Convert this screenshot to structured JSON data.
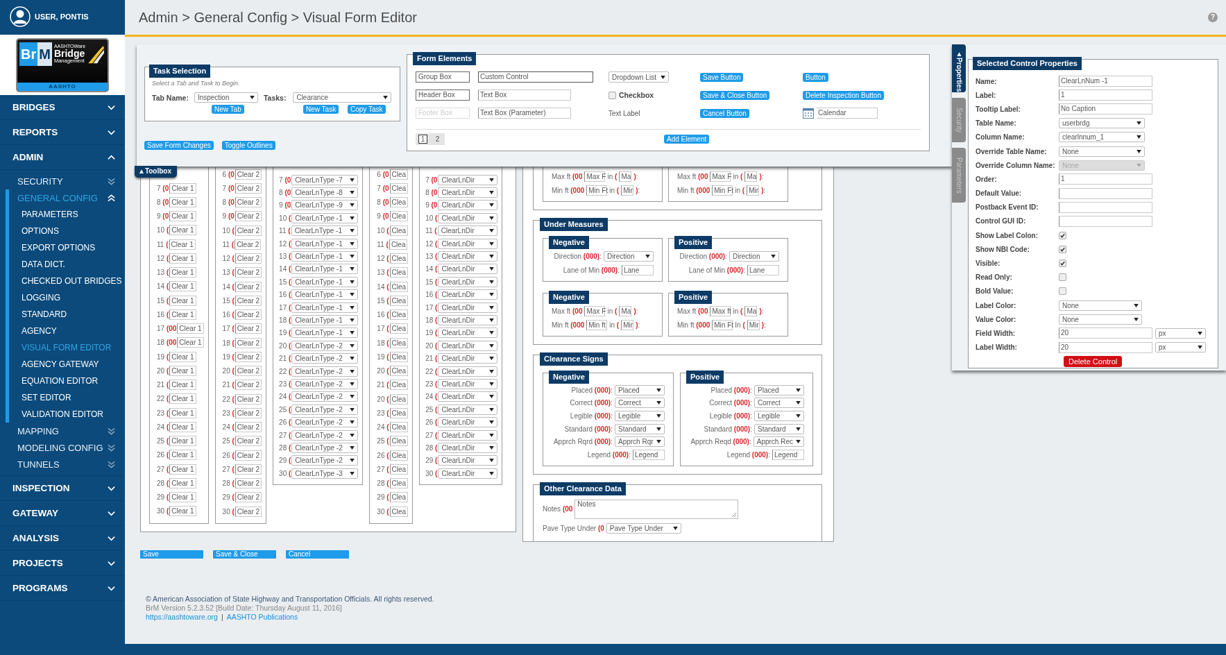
{
  "user": {
    "name": "USER, PONTIS"
  },
  "logo": {
    "left": "Br",
    "right": "M",
    "small": "AASHTOWare",
    "name": "Bridge",
    "sub": "Management",
    "footer": "AASHTO"
  },
  "breadcrumb": "Admin > General Config > Visual Form Editor",
  "help": "?",
  "sidebar": {
    "items": [
      {
        "label": "BRIDGES",
        "expanded": false,
        "selected": false
      },
      {
        "label": "REPORTS",
        "expanded": false,
        "selected": false
      },
      {
        "label": "ADMIN",
        "expanded": true,
        "selected": false,
        "children": [
          {
            "label": "SECURITY",
            "expanded": false,
            "selected": false
          },
          {
            "label": "GENERAL CONFIG",
            "expanded": true,
            "selected": true,
            "children": [
              {
                "label": "PARAMETERS",
                "selected": false
              },
              {
                "label": "OPTIONS",
                "selected": false
              },
              {
                "label": "EXPORT OPTIONS",
                "selected": false
              },
              {
                "label": "DATA DICT.",
                "selected": false
              },
              {
                "label": "CHECKED OUT BRIDGES",
                "selected": false
              },
              {
                "label": "LOGGING",
                "selected": false
              },
              {
                "label": "STANDARD",
                "selected": false
              },
              {
                "label": "AGENCY",
                "selected": false
              },
              {
                "label": "VISUAL FORM EDITOR",
                "selected": true
              },
              {
                "label": "AGENCY GATEWAY",
                "selected": false
              },
              {
                "label": "EQUATION EDITOR",
                "selected": false
              },
              {
                "label": "SET EDITOR",
                "selected": false
              },
              {
                "label": "VALIDATION EDITOR",
                "selected": false
              }
            ]
          },
          {
            "label": "MAPPING",
            "expanded": false,
            "selected": false
          },
          {
            "label": "MODELING CONFIG",
            "expanded": false,
            "selected": false
          },
          {
            "label": "TUNNELS",
            "expanded": false,
            "selected": false
          }
        ]
      },
      {
        "label": "INSPECTION",
        "expanded": false,
        "selected": false
      },
      {
        "label": "GATEWAY",
        "expanded": false,
        "selected": false
      },
      {
        "label": "ANALYSIS",
        "expanded": false,
        "selected": false
      },
      {
        "label": "PROJECTS",
        "expanded": false,
        "selected": false
      },
      {
        "label": "PROGRAMS",
        "expanded": false,
        "selected": false
      }
    ]
  },
  "toolbox": {
    "tab": "▲Toolbox",
    "task_selection": {
      "title": "Task Selection",
      "hint": "Select a Tab and Task to Begin.",
      "tab_label": "Tab Name:",
      "tab_value": "Inspection",
      "tasks_label": "Tasks:",
      "tasks_value": "Clearance",
      "buttons": [
        "New Tab",
        "New Task",
        "Copy Task"
      ]
    },
    "actions": [
      "Save Form Changes",
      "Toggle Outlines"
    ],
    "form_elements": {
      "title": "Form Elements",
      "items": [
        {
          "kind": "box",
          "label": "Group Box"
        },
        {
          "kind": "wide-input",
          "label": "Custom Control"
        },
        {
          "kind": "select",
          "label": "Dropdown List"
        },
        {
          "kind": "button",
          "label": "Save Button"
        },
        {
          "kind": "button",
          "label": "Button"
        },
        {
          "kind": "box",
          "label": "Header Box"
        },
        {
          "kind": "input",
          "label": "Text Box"
        },
        {
          "kind": "checkbox",
          "label": "Checkbox",
          "checked": false
        },
        {
          "kind": "button",
          "label": "Save & Close Button"
        },
        {
          "kind": "button",
          "label": "Delete Inspection Button"
        },
        {
          "kind": "ghost-box",
          "label": "Footer Box"
        },
        {
          "kind": "input",
          "label": "Text Box (Parameter)"
        },
        {
          "kind": "label",
          "label": "Text Label"
        },
        {
          "kind": "button",
          "label": "Cancel Button"
        },
        {
          "kind": "calendar",
          "label": "Calendar"
        }
      ],
      "pages": [
        {
          "label": "1",
          "selected": true
        },
        {
          "label": "2",
          "selected": false
        }
      ],
      "add_button": "Add Element"
    }
  },
  "properties": {
    "tabs": [
      {
        "label": "▲Properties",
        "selected": true
      },
      {
        "label": "Security",
        "selected": false
      },
      {
        "label": "Parameters",
        "selected": false
      }
    ],
    "title": "Selected Control Properties",
    "fields": [
      {
        "kind": "input",
        "label": "Name:",
        "value": "ClearLnNum -1"
      },
      {
        "kind": "input",
        "label": "Label:",
        "value": "1"
      },
      {
        "kind": "input",
        "label": "Tooltip Label:",
        "value": "No Caption"
      },
      {
        "kind": "select",
        "label": "Table Name:",
        "value": "userbrdg",
        "disabled": false
      },
      {
        "kind": "select",
        "label": "Column Name:",
        "value": "clearlnnum_1",
        "disabled": false
      },
      {
        "kind": "select",
        "label": "Override Table Name:",
        "value": "None",
        "disabled": false
      },
      {
        "kind": "select",
        "label": "Override Column Name:",
        "value": "None",
        "disabled": true
      },
      {
        "kind": "input",
        "label": "Order:",
        "value": "1"
      },
      {
        "kind": "input",
        "label": "Default Value:"
      },
      {
        "kind": "input",
        "label": "Postback Event ID:"
      },
      {
        "kind": "input",
        "label": "Control GUI ID:"
      },
      {
        "kind": "checkbox",
        "label": "Show Label Colon:",
        "checked": true
      },
      {
        "kind": "checkbox",
        "label": "Show NBI Code:",
        "checked": true
      },
      {
        "kind": "checkbox",
        "label": "Visible:",
        "checked": true
      },
      {
        "kind": "checkbox",
        "label": "Read Only:",
        "checked": false
      },
      {
        "kind": "checkbox",
        "label": "Bold Value:",
        "checked": false
      },
      {
        "kind": "small-select",
        "label": "Label Color:",
        "value": "None"
      },
      {
        "kind": "small-select",
        "label": "Value Color:",
        "value": "None"
      },
      {
        "kind": "input-unit",
        "label": "Field Width:",
        "value": "20",
        "unit": "px"
      },
      {
        "kind": "input-unit",
        "label": "Label Width:",
        "value": "20",
        "unit": "px"
      }
    ],
    "delete_button": "Delete Control"
  },
  "form": {
    "columns": [
      {
        "kind": "text",
        "rows": [
          {
            "n": "7",
            "c": "(0",
            "v": "Clear 1"
          },
          {
            "n": "8",
            "c": "(0",
            "v": "Clear 1"
          },
          {
            "n": "9",
            "c": "(0",
            "v": "Clear 1"
          },
          {
            "n": "10",
            "c": "(",
            "v": "Clear 1"
          },
          {
            "n": "11",
            "c": "(",
            "v": "Clear 1"
          },
          {
            "n": "12",
            "c": "(",
            "v": "Clear 1"
          },
          {
            "n": "13",
            "c": "(",
            "v": "Clear 1"
          },
          {
            "n": "14",
            "c": "(",
            "v": "Clear 1"
          },
          {
            "n": "15",
            "c": "(",
            "v": "Clear 1"
          },
          {
            "n": "16",
            "c": "(",
            "v": "Clear 1"
          },
          {
            "n": "17",
            "c": "(00",
            "v": "Clear 1"
          },
          {
            "n": "18",
            "c": "(00",
            "v": "Clear 1"
          },
          {
            "n": "19",
            "c": "(",
            "v": "Clear 1"
          },
          {
            "n": "20",
            "c": "(",
            "v": "Clear 1"
          },
          {
            "n": "21",
            "c": "(",
            "v": "Clear 1"
          },
          {
            "n": "22",
            "c": "(",
            "v": "Clear 1"
          },
          {
            "n": "23",
            "c": "(",
            "v": "Clear 1"
          },
          {
            "n": "24",
            "c": "(",
            "v": "Clear 1"
          },
          {
            "n": "25",
            "c": "(",
            "v": "Clear 1"
          },
          {
            "n": "26",
            "c": "(",
            "v": "Clear 1"
          },
          {
            "n": "27",
            "c": "(",
            "v": "Clear 1"
          },
          {
            "n": "28",
            "c": "(",
            "v": "Clear 1"
          },
          {
            "n": "29",
            "c": "(",
            "v": "Clear 1"
          },
          {
            "n": "30",
            "c": "(",
            "v": "Clear 1"
          }
        ]
      },
      {
        "kind": "text",
        "rows": [
          {
            "n": "6",
            "c": "(0",
            "v": "Clear 2"
          },
          {
            "n": "7",
            "c": "(0",
            "v": "Clear 2"
          },
          {
            "n": "8",
            "c": "(0",
            "v": "Clear 2"
          },
          {
            "n": "9",
            "c": "(0",
            "v": "Clear 2"
          },
          {
            "n": "10",
            "c": "(",
            "v": "Clear 2"
          },
          {
            "n": "11",
            "c": "(",
            "v": "Clear 2"
          },
          {
            "n": "12",
            "c": "(",
            "v": "Clear 2"
          },
          {
            "n": "13",
            "c": "(",
            "v": "Clear 2"
          },
          {
            "n": "14",
            "c": "(",
            "v": "Clear 2"
          },
          {
            "n": "15",
            "c": "(",
            "v": "Clear 2"
          },
          {
            "n": "16",
            "c": "(",
            "v": "Clear 2"
          },
          {
            "n": "17",
            "c": "(",
            "v": "Clear 2"
          },
          {
            "n": "18",
            "c": "(",
            "v": "Clear 2"
          },
          {
            "n": "19",
            "c": "(",
            "v": "Clear 2"
          },
          {
            "n": "20",
            "c": "(",
            "v": "Clear 2"
          },
          {
            "n": "21",
            "c": "(",
            "v": "Clear 2"
          },
          {
            "n": "22",
            "c": "(",
            "v": "Clear 2"
          },
          {
            "n": "23",
            "c": "(",
            "v": "Clear 2"
          },
          {
            "n": "24",
            "c": "(",
            "v": "Clear 2"
          },
          {
            "n": "25",
            "c": "(",
            "v": "Clear 2"
          },
          {
            "n": "26",
            "c": "(",
            "v": "Clear 2"
          },
          {
            "n": "27",
            "c": "(",
            "v": "Clear 2"
          },
          {
            "n": "28",
            "c": "(",
            "v": "Clear 2"
          },
          {
            "n": "29",
            "c": "(",
            "v": "Clear 2"
          },
          {
            "n": "30",
            "c": "(",
            "v": "Clear 2"
          }
        ]
      },
      {
        "kind": "select",
        "rows": [
          {
            "n": "7",
            "c": "(0",
            "v": "ClearLnType -7"
          },
          {
            "n": "8",
            "c": "(0",
            "v": "ClearLnType -8"
          },
          {
            "n": "9",
            "c": "(0",
            "v": "ClearLnType -9"
          },
          {
            "n": "10",
            "c": "(",
            "v": "ClearLnType -1"
          },
          {
            "n": "11",
            "c": "(",
            "v": "ClearLnType -1"
          },
          {
            "n": "12",
            "c": "(",
            "v": "ClearLnType -1"
          },
          {
            "n": "13",
            "c": "(",
            "v": "ClearLnType -1"
          },
          {
            "n": "14",
            "c": "(",
            "v": "ClearLnType -1"
          },
          {
            "n": "15",
            "c": "(",
            "v": "ClearLnType -1"
          },
          {
            "n": "16",
            "c": "(",
            "v": "ClearLnType -1"
          },
          {
            "n": "17",
            "c": "(",
            "v": "ClearLnType -1"
          },
          {
            "n": "18",
            "c": "(",
            "v": "ClearLnType -1"
          },
          {
            "n": "19",
            "c": "(",
            "v": "ClearLnType -1"
          },
          {
            "n": "20",
            "c": "(",
            "v": "ClearLnType -2"
          },
          {
            "n": "21",
            "c": "(",
            "v": "ClearLnType -2"
          },
          {
            "n": "22",
            "c": "(",
            "v": "ClearLnType -2"
          },
          {
            "n": "23",
            "c": "(",
            "v": "ClearLnType -2"
          },
          {
            "n": "24",
            "c": "(",
            "v": "ClearLnType -2"
          },
          {
            "n": "25",
            "c": "(",
            "v": "ClearLnType -2"
          },
          {
            "n": "26",
            "c": "(",
            "v": "ClearLnType -2"
          },
          {
            "n": "27",
            "c": "(",
            "v": "ClearLnType -2"
          },
          {
            "n": "28",
            "c": "(",
            "v": "ClearLnType -2"
          },
          {
            "n": "29",
            "c": "(",
            "v": "ClearLnType -2"
          },
          {
            "n": "30",
            "c": "(",
            "v": "ClearLnType -3"
          }
        ]
      },
      {
        "kind": "text",
        "rows": [
          {
            "n": "6",
            "c": "(0",
            "v": "Clea"
          },
          {
            "n": "7",
            "c": "(0",
            "v": "Clea"
          },
          {
            "n": "8",
            "c": "(0",
            "v": "Clea"
          },
          {
            "n": "9",
            "c": "(0",
            "v": "Clea"
          },
          {
            "n": "10",
            "c": "(",
            "v": "Clea"
          },
          {
            "n": "11",
            "c": "(",
            "v": "Clea"
          },
          {
            "n": "12",
            "c": "(",
            "v": "Clea"
          },
          {
            "n": "13",
            "c": "(",
            "v": "Clea"
          },
          {
            "n": "14",
            "c": "(",
            "v": "Clea"
          },
          {
            "n": "15",
            "c": "(",
            "v": "Clea"
          },
          {
            "n": "16",
            "c": "(",
            "v": "Clea"
          },
          {
            "n": "17",
            "c": "(",
            "v": "Clea"
          },
          {
            "n": "18",
            "c": "(",
            "v": "Clea"
          },
          {
            "n": "19",
            "c": "(",
            "v": "Clea"
          },
          {
            "n": "20",
            "c": "(",
            "v": "Clea"
          },
          {
            "n": "21",
            "c": "(",
            "v": "Clea"
          },
          {
            "n": "20",
            "c": "(",
            "v": "Clea"
          },
          {
            "n": "23",
            "c": "(",
            "v": "Clea"
          },
          {
            "n": "24",
            "c": "(",
            "v": "Clea"
          },
          {
            "n": "25",
            "c": "(",
            "v": "Clea"
          },
          {
            "n": "26",
            "c": "(",
            "v": "Clea"
          },
          {
            "n": "27",
            "c": "(",
            "v": "Clea"
          },
          {
            "n": "28",
            "c": "(",
            "v": "Clea"
          },
          {
            "n": "29",
            "c": "(",
            "v": "Clea"
          },
          {
            "n": "30",
            "c": "(",
            "v": "Clea"
          }
        ]
      },
      {
        "kind": "select",
        "rows": [
          {
            "n": "7",
            "c": "(0",
            "v": "ClearLnDir"
          },
          {
            "n": "8",
            "c": "(0",
            "v": "ClearLnDir"
          },
          {
            "n": "9",
            "c": "(0",
            "v": "ClearLnDir"
          },
          {
            "n": "10",
            "c": "(",
            "v": "ClearLnDir"
          },
          {
            "n": "11",
            "c": "(",
            "v": "ClearLnDir"
          },
          {
            "n": "12",
            "c": "(",
            "v": "ClearLnDir"
          },
          {
            "n": "13",
            "c": "(",
            "v": "ClearLnDir"
          },
          {
            "n": "14",
            "c": "(",
            "v": "ClearLnDir"
          },
          {
            "n": "15",
            "c": "(",
            "v": "ClearLnDir"
          },
          {
            "n": "16",
            "c": "(",
            "v": "ClearLnDir"
          },
          {
            "n": "17",
            "c": "(",
            "v": "ClearLnDir"
          },
          {
            "n": "18",
            "c": "(",
            "v": "ClearLnDir"
          },
          {
            "n": "19",
            "c": "(",
            "v": "ClearLnDir"
          },
          {
            "n": "20",
            "c": "(",
            "v": "ClearLnDir"
          },
          {
            "n": "21",
            "c": "(",
            "v": "ClearLnDir"
          },
          {
            "n": "22",
            "c": "(",
            "v": "ClearLnDir"
          },
          {
            "n": "23",
            "c": "(",
            "v": "ClearLnDir"
          },
          {
            "n": "24",
            "c": "(",
            "v": "ClearLnDir"
          },
          {
            "n": "25",
            "c": "(",
            "v": "ClearLnDir"
          },
          {
            "n": "26",
            "c": "(",
            "v": "ClearLnDir"
          },
          {
            "n": "27",
            "c": "(",
            "v": "ClearLnDir"
          },
          {
            "n": "28",
            "c": "(",
            "v": "ClearLnDir"
          },
          {
            "n": "29",
            "c": "(",
            "v": "ClearLnDir"
          },
          {
            "n": "30",
            "c": "(",
            "v": "ClearLnDir"
          }
        ]
      }
    ],
    "sections": [
      {
        "groups": [
          {
            "rows": [
              {
                "kind": "measure",
                "label": "Max ft",
                "code": "(00",
                "value": "Max F",
                "unit": "in",
                "code2": "(",
                "value2": "Ma",
                "code3": ")",
                "sep": ":"
              },
              {
                "kind": "measure",
                "label": "Min ft",
                "code": "(000",
                "value": "Min Ft",
                "unit": "in",
                "code2": "(",
                "value2": "Mir",
                "code3": ")",
                "sep": ":"
              }
            ]
          },
          {
            "rows": [
              {
                "kind": "measure",
                "label": "Max ft",
                "code": "(00",
                "value": "Max F",
                "unit": "in",
                "code2": "(",
                "value2": "Ma",
                "code3": ")",
                "sep": ":"
              },
              {
                "kind": "measure",
                "label": "Min ft",
                "code": "(000",
                "value": "Min Ft",
                "unit": "in",
                "code2": "(",
                "value2": "Mir",
                "code3": ")",
                "sep": ":"
              }
            ]
          }
        ]
      },
      {
        "title": "Under Measures",
        "groups": [
          {
            "title": "Negative",
            "rows": [
              {
                "kind": "select",
                "label": "Direction",
                "code": "(000)",
                "sep": ":",
                "value": "Direction"
              },
              {
                "kind": "text",
                "label": "Lane of Min",
                "code": "(000)",
                "sep": ":",
                "value": "Lane"
              }
            ]
          },
          {
            "title": "Positive",
            "rows": [
              {
                "kind": "select",
                "label": "Direction",
                "code": "(000)",
                "sep": ":",
                "value": "Direction"
              },
              {
                "kind": "text",
                "label": "Lane of Min",
                "code": "(000)",
                "sep": ":",
                "value": "Lane"
              }
            ]
          },
          {
            "title": "Negative",
            "rows": [
              {
                "kind": "measure",
                "label": "Max ft",
                "code": "(00",
                "value": "Max F",
                "unit": "in",
                "code2": "(",
                "value2": "Ma",
                "code3": ")",
                "sep": ":"
              },
              {
                "kind": "measure",
                "label": "Min ft",
                "code": "(000",
                "value": "Min ft",
                "unit": "in",
                "code2": "(",
                "value2": "Mir",
                "code3": ")",
                "sep": ":"
              }
            ]
          },
          {
            "title": "Positive",
            "rows": [
              {
                "kind": "measure",
                "label": "Max ft",
                "code": "(00",
                "value": "Max ft",
                "unit": "in",
                "code2": "(",
                "value2": "Ma",
                "code3": ")",
                "sep": ":"
              },
              {
                "kind": "measure",
                "label": "Min ft",
                "code": "(000",
                "value": "Min Ft",
                "unit": "In",
                "code2": "(",
                "value2": "Mir",
                "code3": ")",
                "sep": ":"
              }
            ]
          }
        ]
      },
      {
        "title": "Clearance Signs",
        "groups": [
          {
            "title": "Negative",
            "rows": [
              {
                "kind": "select",
                "label": "Placed",
                "code": "(000)",
                "sep": ":",
                "value": "Placed"
              },
              {
                "kind": "select",
                "label": "Correct",
                "code": "(000)",
                "sep": ":",
                "value": "Correct"
              },
              {
                "kind": "select",
                "label": "Legible",
                "code": "(000)",
                "sep": ":",
                "value": "Legible"
              },
              {
                "kind": "select",
                "label": "Standard",
                "code": "(000)",
                "sep": ":",
                "value": "Standard"
              },
              {
                "kind": "select",
                "label": "Apprch Rqrd",
                "code": "(000)",
                "sep": ":",
                "value": "Apprch Rqr"
              },
              {
                "kind": "text",
                "label": "Legend",
                "code": "(000)",
                "sep": ":",
                "value": "Legend"
              }
            ]
          },
          {
            "title": "Positive",
            "rows": [
              {
                "kind": "select",
                "label": "Placed",
                "code": "(000)",
                "sep": ":",
                "value": "Placed"
              },
              {
                "kind": "select",
                "label": "Correct",
                "code": "(000)",
                "sep": ":",
                "value": "Correct"
              },
              {
                "kind": "select",
                "label": "Legible",
                "code": "(000)",
                "sep": ":",
                "value": "Legible"
              },
              {
                "kind": "select",
                "label": "Standard",
                "code": "(000)",
                "sep": ":",
                "value": "Standard"
              },
              {
                "kind": "select",
                "label": "Apprch Reqd",
                "code": "(000)",
                "sep": ":",
                "value": "Apprch Rec"
              },
              {
                "kind": "text",
                "label": "Legend",
                "code": "(000)",
                "sep": ":",
                "value": "Legend"
              }
            ]
          }
        ]
      },
      {
        "title": "Other Clearance Data",
        "rows": [
          {
            "kind": "textarea",
            "label": "Notes",
            "code": "(00",
            "value": "Notes"
          },
          {
            "kind": "select",
            "label": "Pave Type Under",
            "code": "(0",
            "value": "Pave Type Under"
          }
        ]
      }
    ],
    "buttons": [
      "Save",
      "Save & Close",
      "Cancel"
    ]
  },
  "footer": {
    "copyright": "© American Association of State Highway and Transportation Officials. All rights reserved.",
    "version": "BrM Version 5.2.3.52 [Build Date: Thursday August 11, 2016]",
    "links": [
      "https://aashtoware.org",
      "AASHTO Publications"
    ],
    "separator": "|"
  }
}
